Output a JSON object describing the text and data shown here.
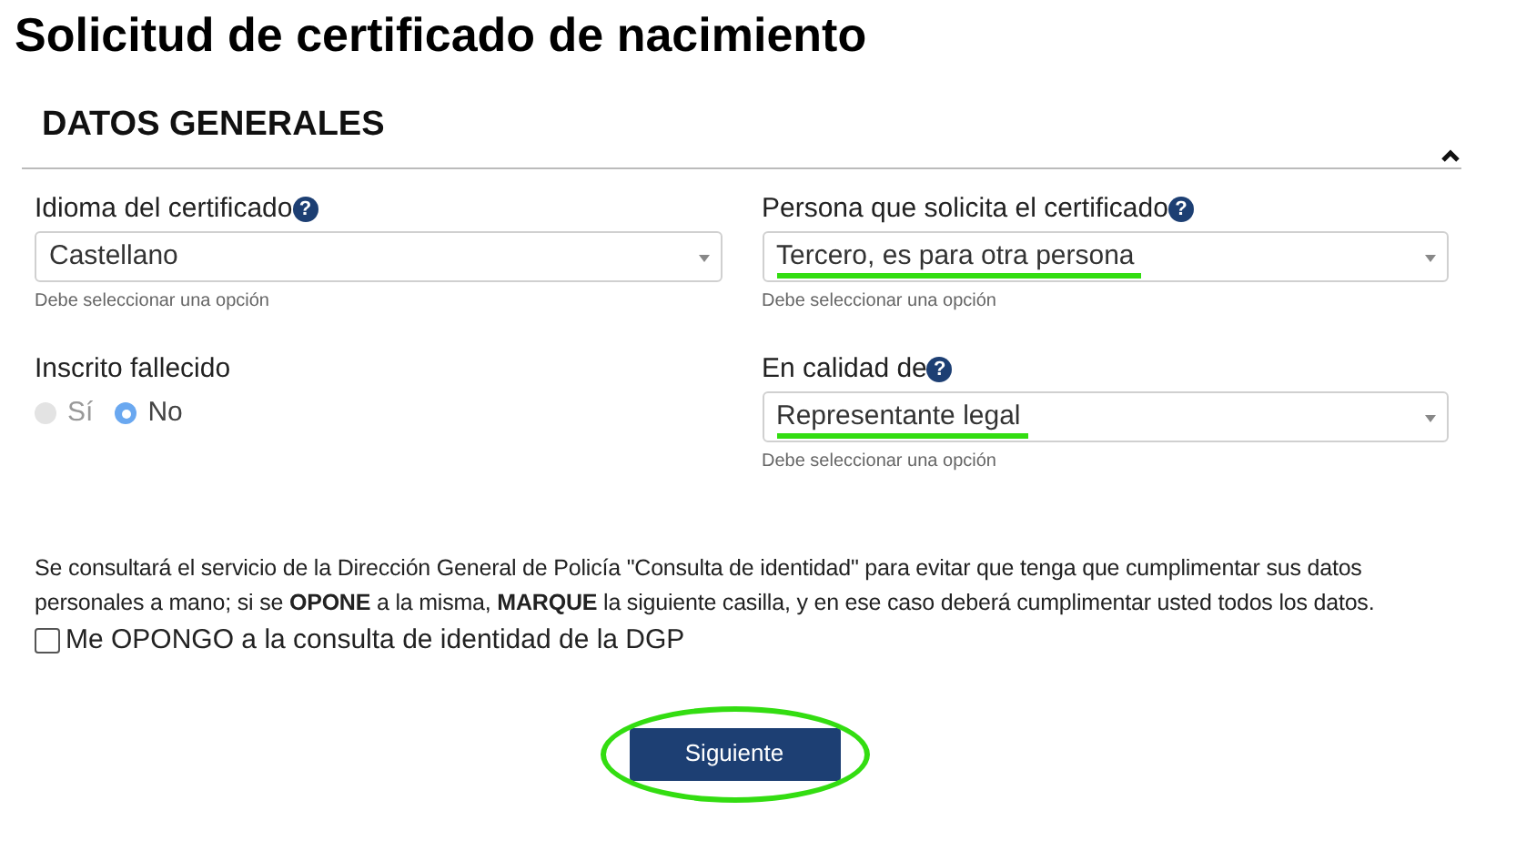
{
  "page_title": "Solicitud de certificado de nacimiento",
  "section": {
    "title": "DATOS GENERALES",
    "expanded": true
  },
  "fields": [
    {
      "kind": "select",
      "label": "Idioma del certificado",
      "help": "?",
      "value": "Castellano",
      "hint": "Debe seleccionar una opción",
      "highlighted": false
    },
    {
      "kind": "select",
      "label": "Persona que solicita el certificado",
      "help": "?",
      "value": "Tercero, es para otra persona",
      "hint": "Debe seleccionar una opción",
      "highlighted": true
    },
    {
      "kind": "radio",
      "label": "Inscrito fallecido",
      "options": [
        {
          "label": "Sí",
          "selected": false
        },
        {
          "label": "No",
          "selected": true
        }
      ]
    },
    {
      "kind": "select",
      "label": "En calidad de",
      "help": "?",
      "value": "Representante legal",
      "hint": "Debe seleccionar una opción",
      "highlighted": true
    }
  ],
  "notice": "Se consultará el servicio de la Dirección General de Policía \"Consulta de identidad\" para evitar que tenga que cumplimentar sus datos personales a mano; si se **OPONE** a la misma, **MARQUE** la siguiente casilla, y en ese caso deberá cumplimentar usted todos los datos.",
  "opt_out": {
    "label": "Me OPONGO a la consulta de identidad de la DGP",
    "checked": false
  },
  "next_button": {
    "label": "Siguiente",
    "circled": true
  }
}
